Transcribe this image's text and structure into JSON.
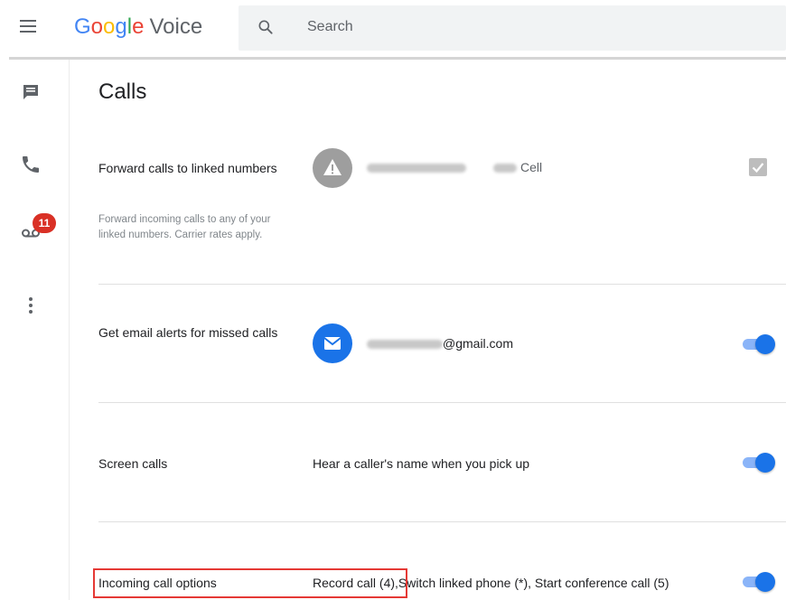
{
  "app": {
    "logo_google": [
      "G",
      "o",
      "o",
      "g",
      "l",
      "e"
    ],
    "logo_voice": "Voice"
  },
  "search": {
    "placeholder": "Search"
  },
  "nav": {
    "voicemail_badge": "11",
    "icons": [
      "messages-icon",
      "calls-icon",
      "voicemail-icon",
      "more-vert-icon"
    ]
  },
  "page": {
    "title": "Calls"
  },
  "settings": {
    "forward": {
      "label": "Forward calls to linked numbers",
      "description": "Forward incoming calls to any of your linked numbers. Carrier rates apply.",
      "number_type": "Cell",
      "checked": true
    },
    "email_alerts": {
      "label": "Get email alerts for missed calls",
      "email_suffix": "@gmail.com",
      "enabled": true
    },
    "screen_calls": {
      "label": "Screen calls",
      "value": "Hear a caller's name when you pick up",
      "enabled": true
    },
    "incoming_options": {
      "label": "Incoming call options",
      "value_part1": "Record call (4),",
      "value_part2": "Switch linked phone (*), Start conference call (5)",
      "enabled": true
    }
  },
  "colors": {
    "accent": "#1a73e8",
    "highlight": "#e53935",
    "badge": "#d93025"
  }
}
